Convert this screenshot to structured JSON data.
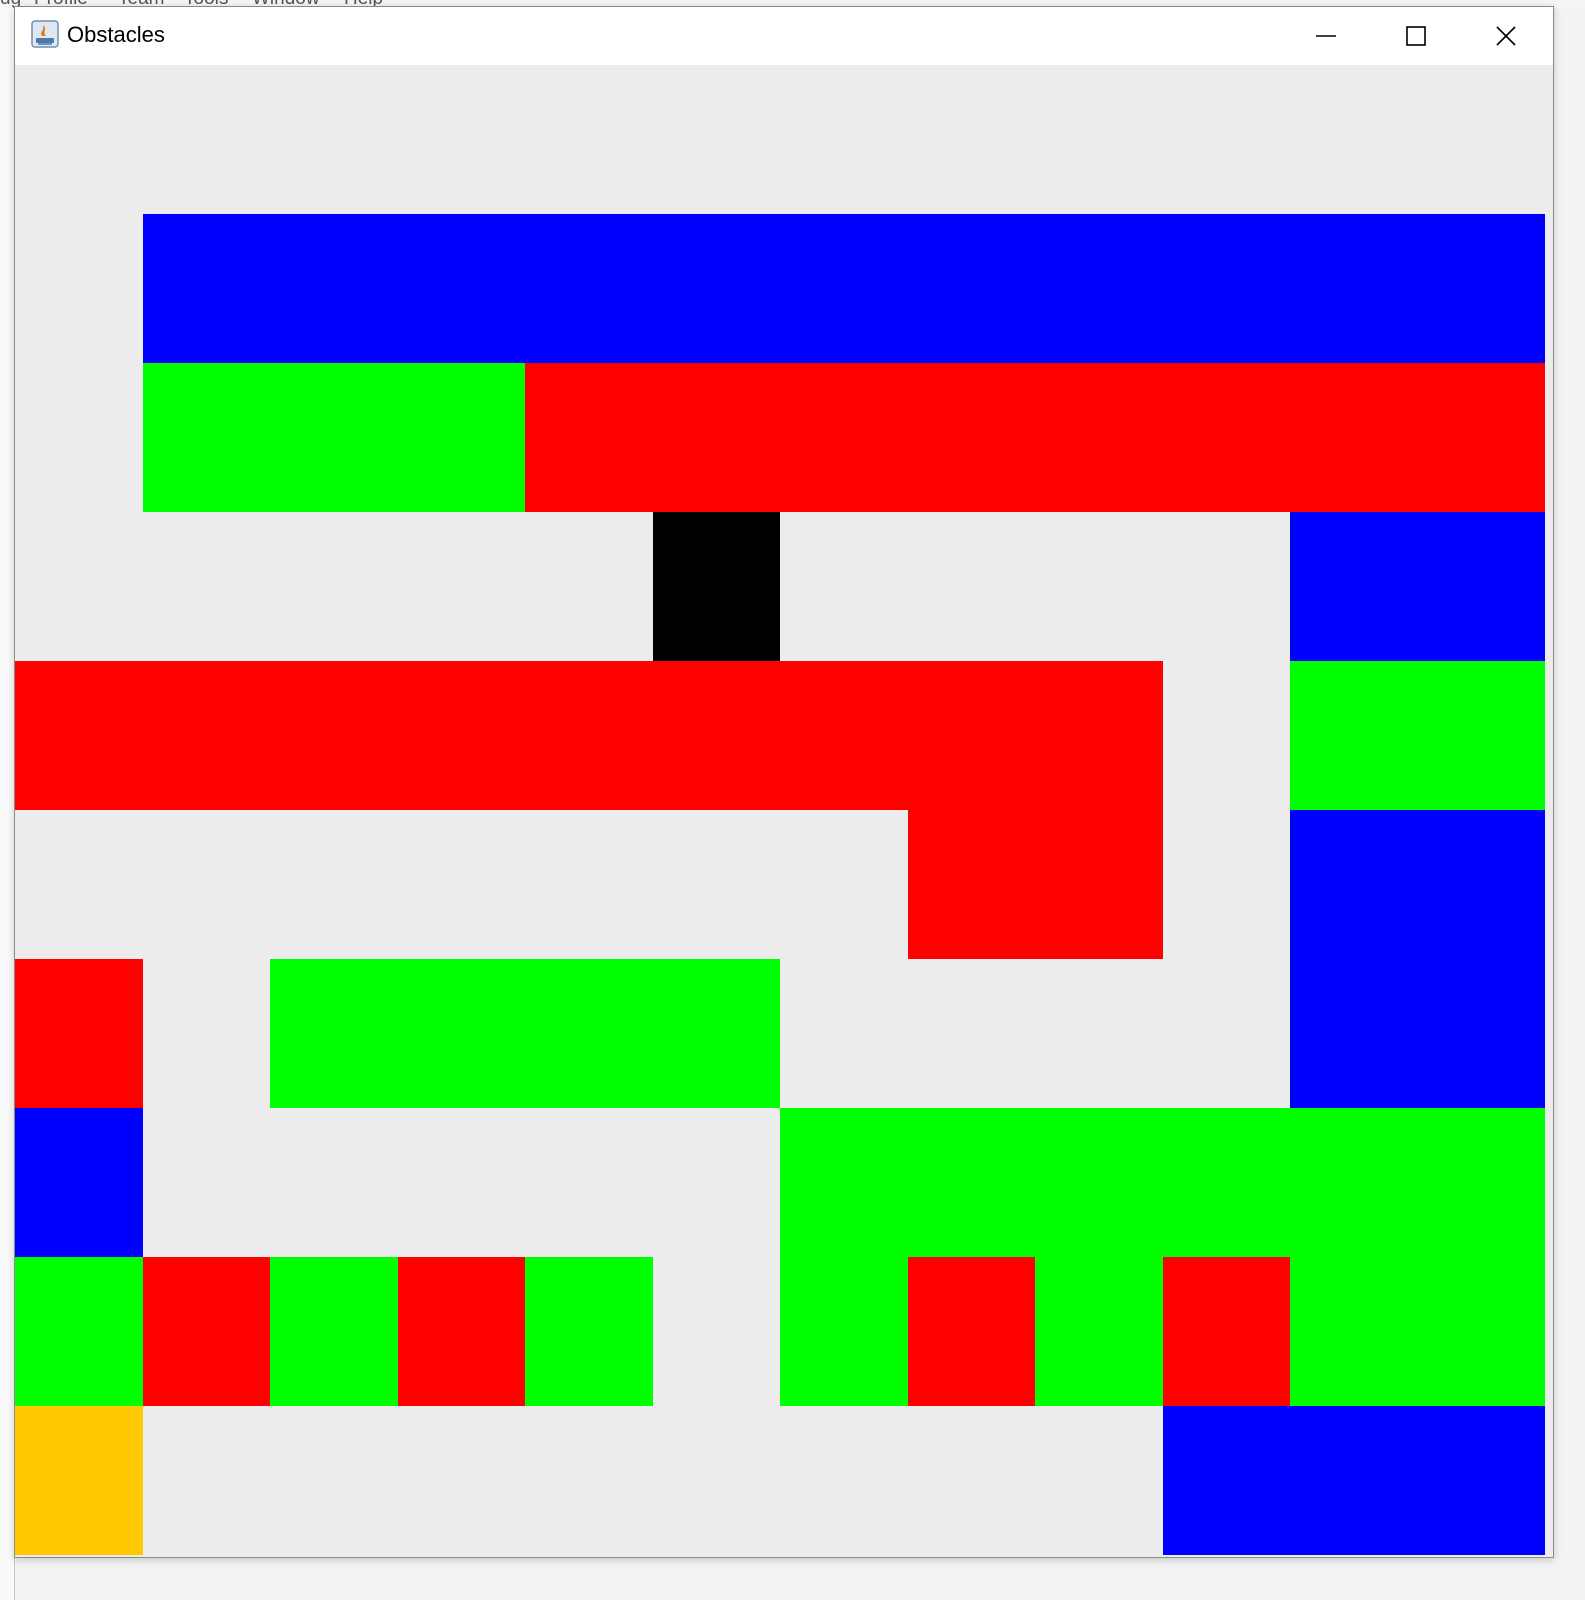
{
  "window": {
    "title": "Obstacles"
  },
  "background_ide": {
    "menu_items": [
      "ug",
      "Profile",
      "Team",
      "Tools",
      "Window",
      "Help"
    ]
  },
  "palette": {
    "B": "#0000ff",
    "G": "#00ff00",
    "R": "#ff0000",
    "K": "#000000",
    "Y": "#ffc800",
    "E": "#eeeeee"
  },
  "grid": {
    "rows": [
      "............",
      ".BBBBBBBBBBB",
      ".GGGRRRRRRRR",
      ".....K....BB",
      "RRRRRRRRR.GG",
      ".......RR.BB",
      "R.GGGG....BB",
      "B.....GGGGGG",
      "GRGRG.GRGRGG",
      "Y........BBB"
    ]
  }
}
